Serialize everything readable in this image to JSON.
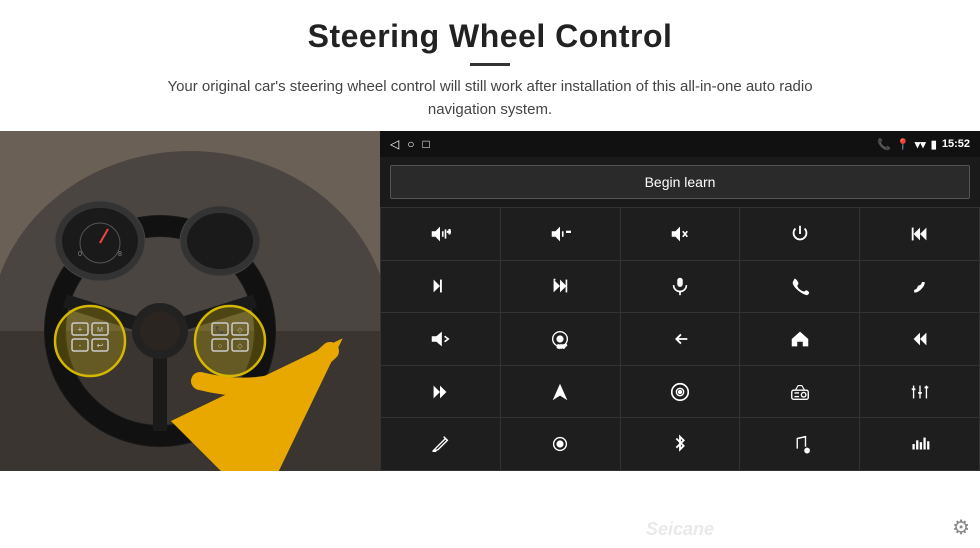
{
  "header": {
    "title": "Steering Wheel Control",
    "subtitle": "Your original car's steering wheel control will still work after installation of this all-in-one auto radio navigation system.",
    "divider": true
  },
  "status_bar": {
    "time": "15:52",
    "nav_icons": [
      "◁",
      "○",
      "□"
    ],
    "right_icons": [
      "📞",
      "📍",
      "📶",
      "🔋"
    ]
  },
  "begin_learn": {
    "label": "Begin learn"
  },
  "controls": {
    "rows": [
      [
        "vol+",
        "vol-",
        "mute",
        "power",
        "prev-track"
      ],
      [
        "next",
        "ff",
        "mic",
        "phone",
        "hang-up"
      ],
      [
        "horn",
        "360cam",
        "back",
        "home",
        "skip-back"
      ],
      [
        "skip-fwd",
        "nav",
        "source",
        "radio",
        "eq"
      ],
      [
        "pen",
        "settings-knob",
        "bluetooth",
        "music",
        "bars"
      ]
    ]
  },
  "watermark": {
    "text": "Seicane"
  }
}
